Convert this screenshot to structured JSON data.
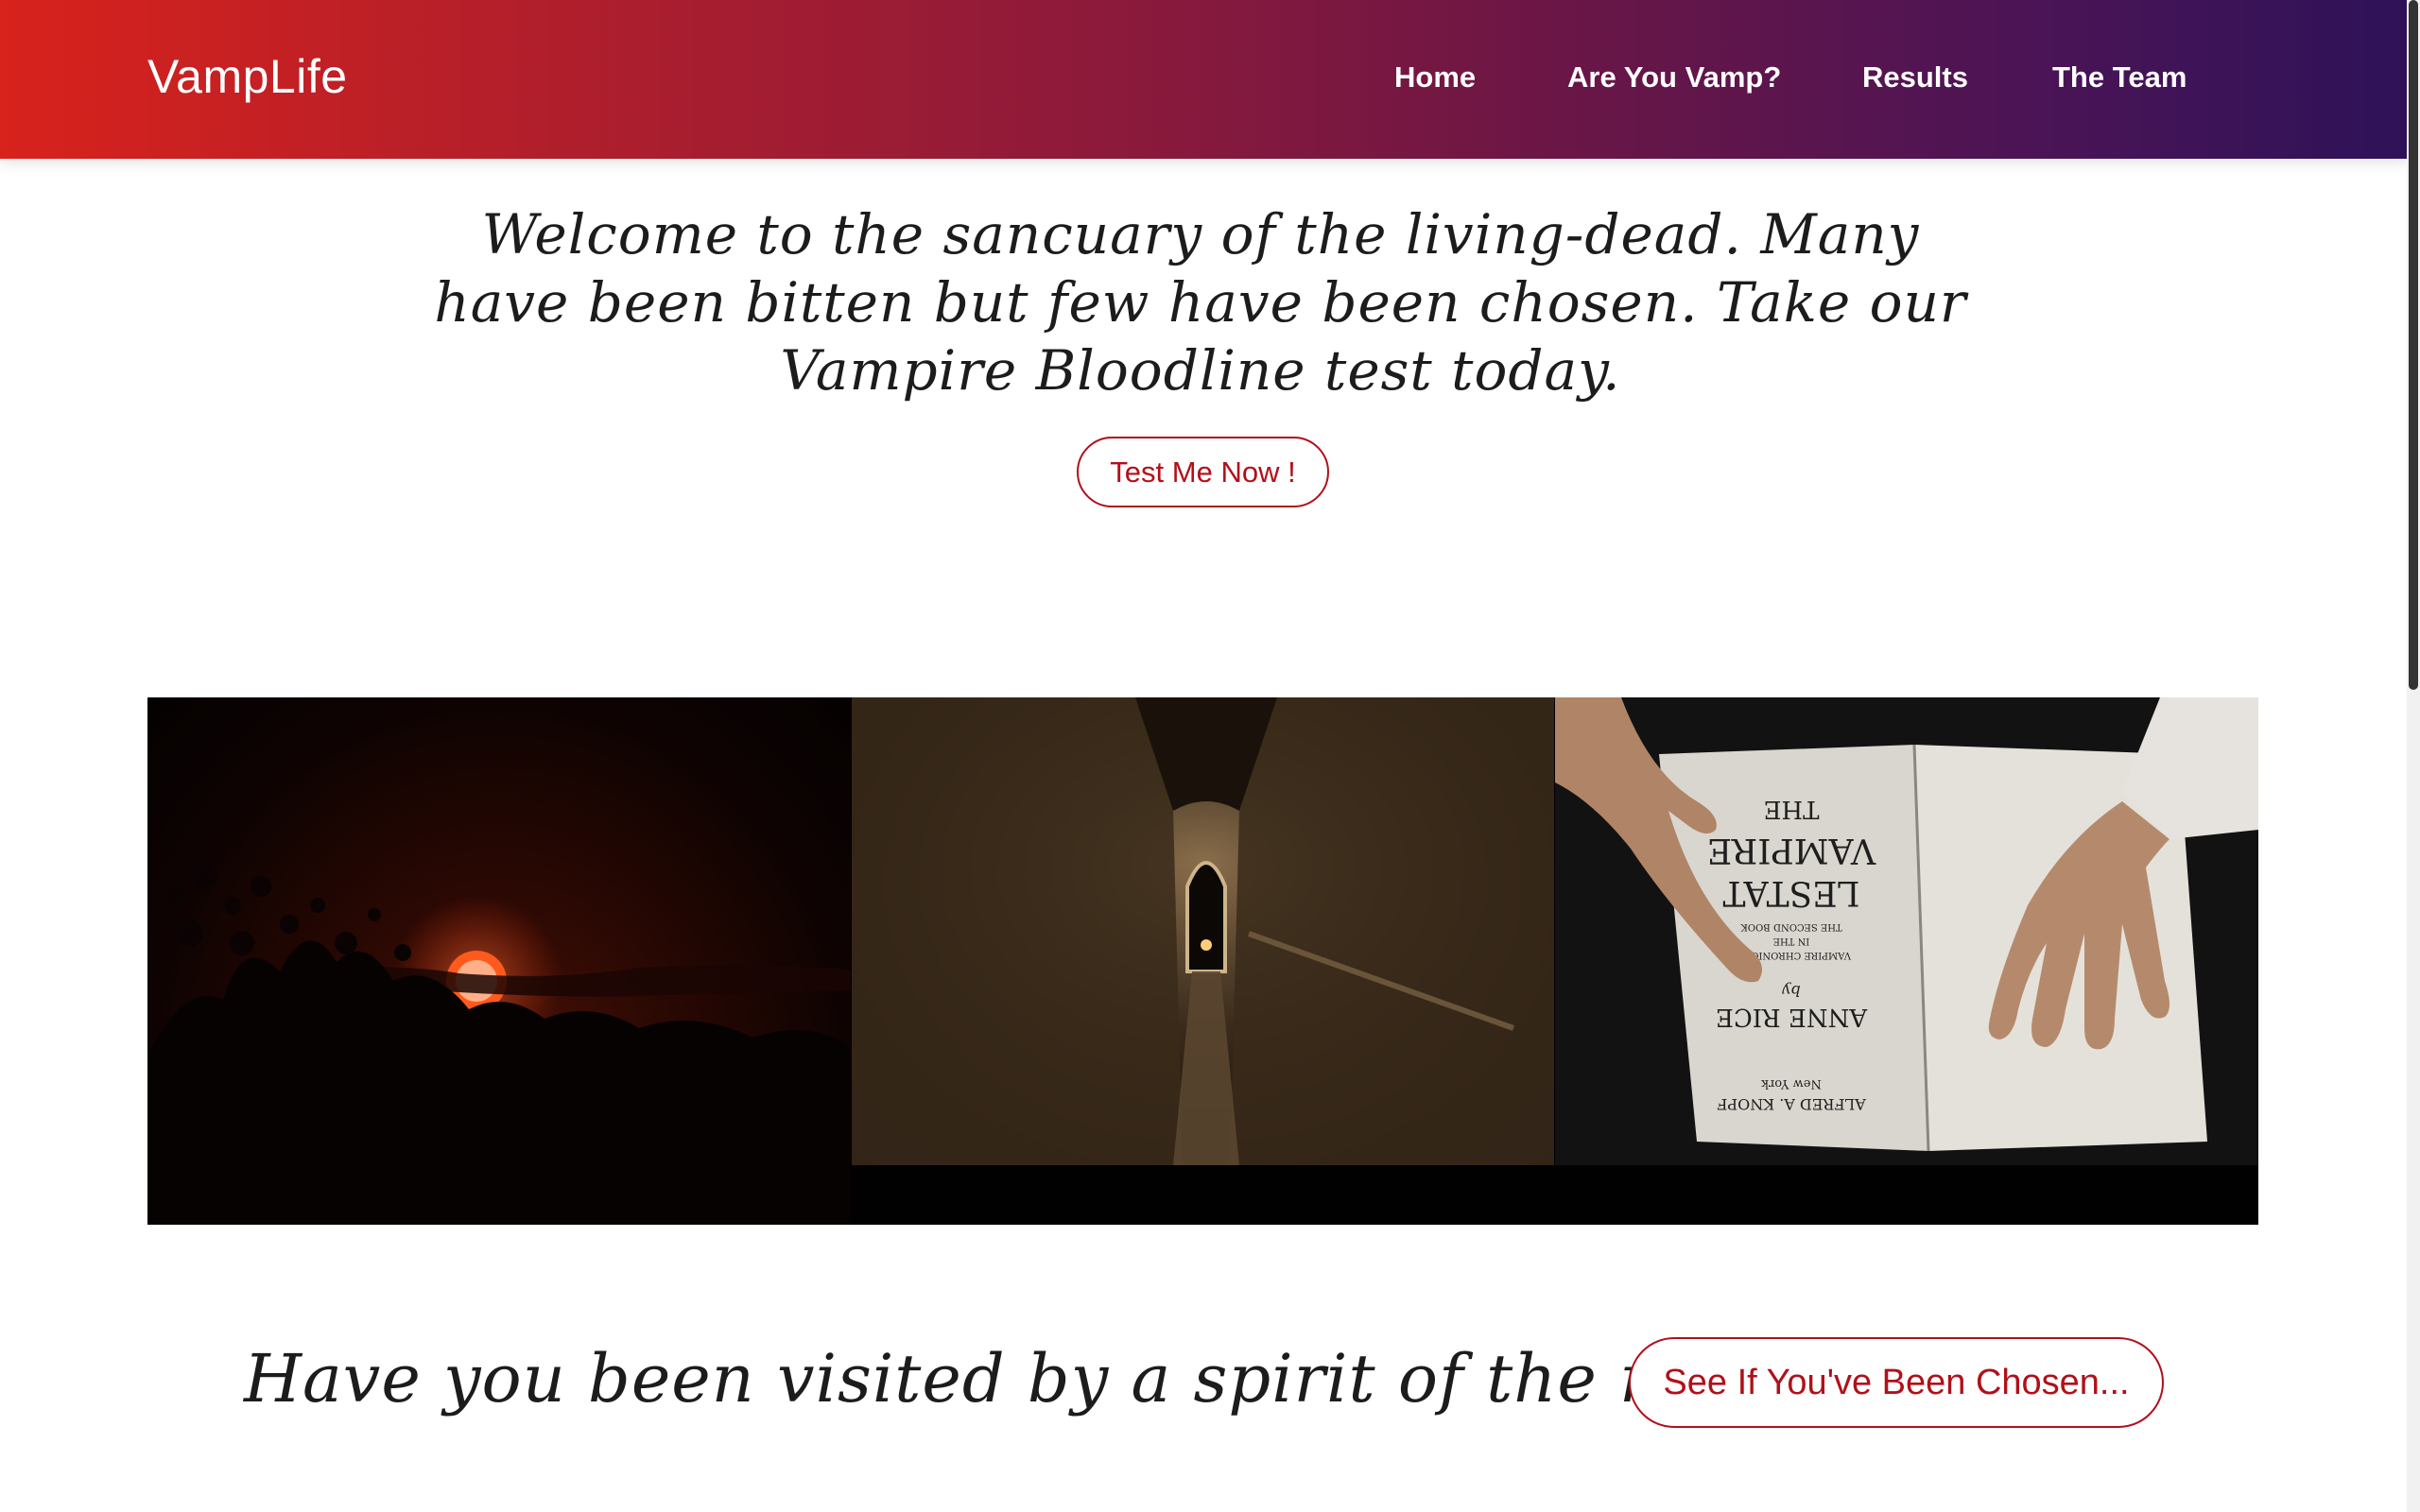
{
  "header": {
    "brand": "VampLife",
    "nav": [
      {
        "label": "Home"
      },
      {
        "label": "Are You Vamp?"
      },
      {
        "label": "Results"
      },
      {
        "label": "The Team"
      }
    ]
  },
  "hero": {
    "text": "Welcome to the sancuary of the living-dead. Many have been bitten but few have been chosen. Take our Vampire Bloodline test today.",
    "button_label": "Test Me Now !"
  },
  "gallery": {
    "book": {
      "title_line1": "THE",
      "title_line2": "VAMPIRE",
      "title_line3": "LESTAT",
      "subtitle1": "THE SECOND BOOK",
      "subtitle2": "IN THE",
      "subtitle3": "VAMPIRE CHRONICLES",
      "by": "by",
      "author": "ANNE RICE",
      "publisher": "ALFRED A. KNOPF",
      "city": "New York"
    }
  },
  "cta": {
    "text": "Have you been visited by a spirit of the night?",
    "button_label": "See If You've Been Chosen..."
  },
  "colors": {
    "accent": "#b1101a",
    "header_gradient_start": "#d8221c",
    "header_gradient_end": "#2e1258",
    "text": "#1c1c1c"
  }
}
